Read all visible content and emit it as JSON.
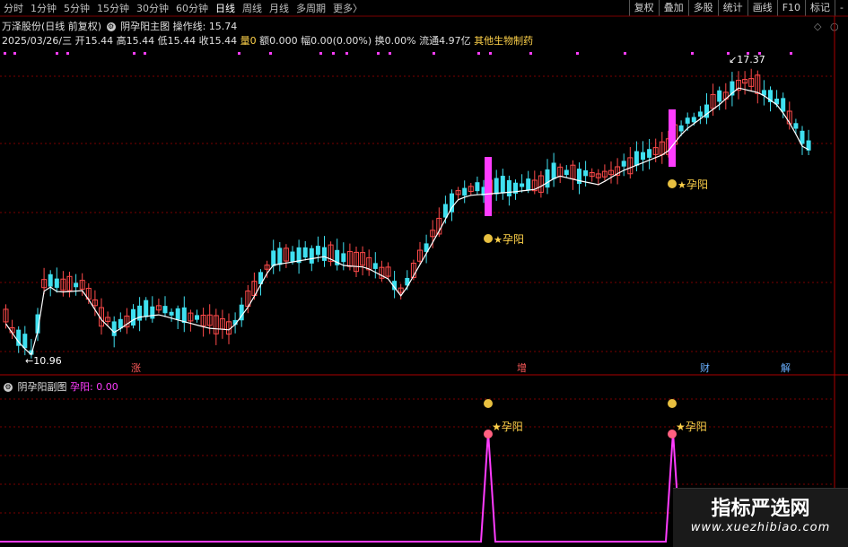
{
  "periods": [
    "分时",
    "1分钟",
    "5分钟",
    "15分钟",
    "30分钟",
    "60分钟",
    "日线",
    "周线",
    "月线",
    "多周期",
    "更多〉"
  ],
  "active_period": "日线",
  "right_buttons": [
    "复权",
    "叠加",
    "多股",
    "统计",
    "画线",
    "F10",
    "标记",
    "-"
  ],
  "header": {
    "stock": "万泽股份(日线 前复权)",
    "main_indicator": "阴孕阳主图",
    "op_label": "操作线:",
    "op_value": "15.74"
  },
  "quote": {
    "date": "2025/03/26/三",
    "open_l": "开",
    "open": "15.44",
    "high_l": "高",
    "high": "15.44",
    "low_l": "低",
    "low": "15.44",
    "close_l": "收",
    "close": "15.44",
    "vol_l": "量",
    "vol": "0",
    "amt_l": "额",
    "amt": "0.000",
    "pct_l": "幅",
    "pct": "0.00(0.00%)",
    "turn_l": "换",
    "turn": "0.00%",
    "float_l": "流通",
    "float": "4.97亿",
    "sector": "其他生物制药"
  },
  "price_labels": {
    "high": "17.37",
    "low": "10.96"
  },
  "signal_label": "孕阳",
  "event_labels": [
    "涨",
    "增",
    "财",
    "解"
  ],
  "sub_panel": {
    "title": "阴孕阳副图",
    "label": "孕阳:",
    "value": "0.00"
  },
  "watermark": {
    "title": "指标严选网",
    "url": "www.xuezhibiao.com"
  },
  "colors": {
    "up": "#ff4a4a",
    "down": "#3fe0f0",
    "ma": "#ffffff",
    "signal": "#ff3cff",
    "label": "#ffd24a"
  }
}
